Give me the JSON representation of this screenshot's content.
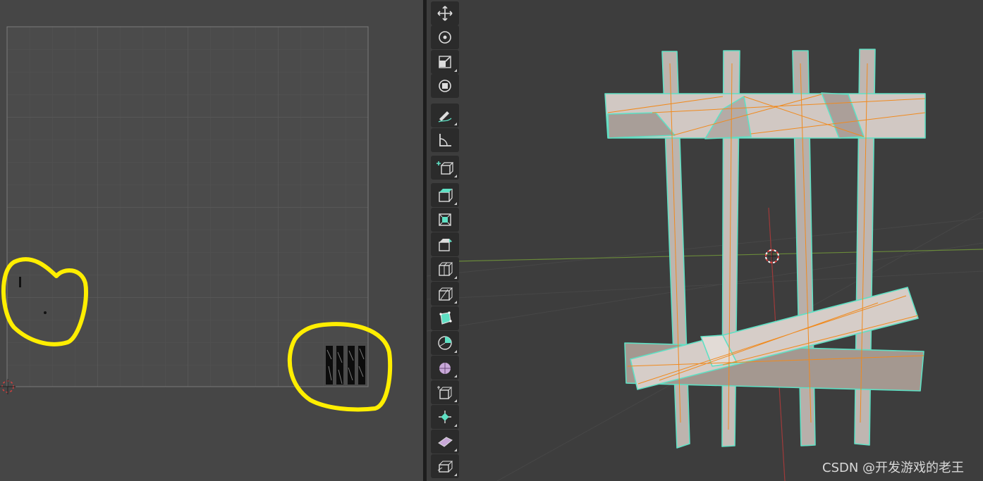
{
  "uv_editor": {},
  "viewport": {},
  "toolbar": {
    "tools": [
      {
        "id": "move",
        "icon": "move-icon",
        "has_options": false
      },
      {
        "id": "rotate",
        "icon": "rotate-icon",
        "has_options": false
      },
      {
        "id": "scale",
        "icon": "scale-icon",
        "has_options": true
      },
      {
        "id": "transform",
        "icon": "transform-icon",
        "has_options": false
      },
      {
        "id": "annotate",
        "icon": "annotate-icon",
        "has_options": true
      },
      {
        "id": "measure",
        "icon": "measure-icon",
        "has_options": false
      },
      {
        "id": "add-cube",
        "icon": "add-cube-icon",
        "has_options": true
      },
      {
        "id": "extrude",
        "icon": "extrude-region-icon",
        "has_options": true
      },
      {
        "id": "inset",
        "icon": "inset-faces-icon",
        "has_options": false
      },
      {
        "id": "bevel",
        "icon": "bevel-icon",
        "has_options": false
      },
      {
        "id": "loop-cut",
        "icon": "loop-cut-icon",
        "has_options": true
      },
      {
        "id": "knife",
        "icon": "knife-icon",
        "has_options": true
      },
      {
        "id": "poly-build",
        "icon": "poly-build-icon",
        "has_options": false
      },
      {
        "id": "spin",
        "icon": "spin-icon",
        "has_options": true
      },
      {
        "id": "smooth",
        "icon": "smooth-icon",
        "has_options": true
      },
      {
        "id": "edge-slide",
        "icon": "edge-slide-icon",
        "has_options": true
      },
      {
        "id": "shrink-fatten",
        "icon": "shrink-fatten-icon",
        "has_options": true
      },
      {
        "id": "shear",
        "icon": "shear-icon",
        "has_options": true
      },
      {
        "id": "rip",
        "icon": "rip-region-icon",
        "has_options": true
      }
    ]
  },
  "watermark": {
    "text": "CSDN @开发游戏的老王"
  },
  "colors": {
    "annotation": "#ffee00",
    "mesh_outline": "#5fe0c4",
    "edge_highlight": "#f08a1e",
    "face_fill": "#c9c0bb"
  }
}
